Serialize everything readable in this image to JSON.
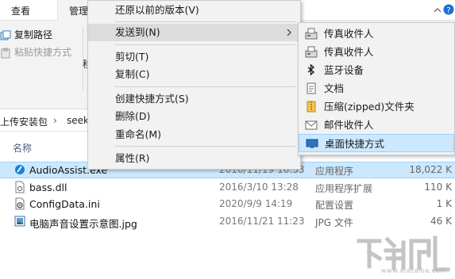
{
  "tabs": [
    {
      "label": "查看"
    },
    {
      "label": "管理"
    }
  ],
  "ribbon": {
    "copy_path": "复制路径",
    "paste_shortcut": "粘贴快捷方式",
    "partial_char": "移"
  },
  "breadcrumb": {
    "folder": "上传安装包",
    "current": "seek"
  },
  "file_list": {
    "header_name": "名称",
    "rows": [
      {
        "name": "AudioAssist.exe",
        "date": "2016/11/19 16:53",
        "type": "应用程序",
        "size": "18,022 K",
        "icon": "exe-app-icon"
      },
      {
        "name": "bass.dll",
        "date": "2016/3/10 13:28",
        "type": "应用程序扩展",
        "size": "110 K",
        "icon": "dll-file-icon"
      },
      {
        "name": "ConfigData.ini",
        "date": "2020/9/9 14:19",
        "type": "配置设置",
        "size": "1 K",
        "icon": "ini-file-icon"
      },
      {
        "name": "电脑声音设置示意图.jpg",
        "date": "2016/11/21 11:23",
        "type": "JPG 文件",
        "size": "46 K",
        "icon": "image-file-icon"
      }
    ]
  },
  "context_menu": {
    "items": [
      {
        "label": "还原以前的版本(V)"
      },
      {
        "label": "发送到(N)"
      },
      {
        "label": "剪切(T)"
      },
      {
        "label": "复制(C)"
      },
      {
        "label": "创建快捷方式(S)"
      },
      {
        "label": "删除(D)"
      },
      {
        "label": "重命名(M)"
      },
      {
        "label": "属性(R)"
      }
    ]
  },
  "send_to_menu": {
    "items": [
      {
        "label": "传真收件人",
        "icon": "fax-icon"
      },
      {
        "label": "传真收件人",
        "icon": "fax-icon"
      },
      {
        "label": "蓝牙设备",
        "icon": "bluetooth-icon"
      },
      {
        "label": "文档",
        "icon": "documents-icon"
      },
      {
        "label": "压缩(zipped)文件夹",
        "icon": "zip-folder-icon"
      },
      {
        "label": "邮件收件人",
        "icon": "mail-icon"
      },
      {
        "label": "桌面快捷方式",
        "icon": "desktop-icon"
      }
    ]
  },
  "watermark": {
    "text": "www.xiazaiba.com"
  },
  "colors": {
    "selection": "#cce8ff",
    "selection_border": "#99d1ff",
    "menu_bg": "#f2f2f2",
    "menu_hover": "#dcdcdc"
  }
}
